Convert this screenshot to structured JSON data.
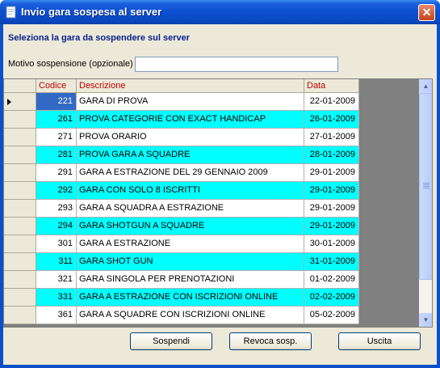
{
  "window": {
    "title": "Invio gara sospesa al server",
    "close_glyph": "✕"
  },
  "heading": "Seleziona la gara da sospendere sul server",
  "motivo": {
    "label": "Motivo sospensione (opzionale)",
    "value": ""
  },
  "grid": {
    "columns": {
      "code": "Codice",
      "desc": "Descrizione",
      "date": "Data"
    },
    "rows": [
      {
        "code": "221",
        "desc": "GARA DI PROVA",
        "date": "22-01-2009",
        "color": "white",
        "selected": true
      },
      {
        "code": "261",
        "desc": "PROVA CATEGORIE CON EXACT HANDICAP",
        "date": "26-01-2009",
        "color": "cyan"
      },
      {
        "code": "271",
        "desc": "PROVA ORARIO",
        "date": "27-01-2009",
        "color": "white"
      },
      {
        "code": "281",
        "desc": "PROVA GARA A SQUADRE",
        "date": "28-01-2009",
        "color": "cyan"
      },
      {
        "code": "291",
        "desc": "GARA A ESTRAZIONE DEL 29 GENNAIO 2009",
        "date": "29-01-2009",
        "color": "white"
      },
      {
        "code": "292",
        "desc": "GARA CON SOLO 8 ISCRITTI",
        "date": "29-01-2009",
        "color": "cyan"
      },
      {
        "code": "293",
        "desc": "GARA A SQUADRA A ESTRAZIONE",
        "date": "29-01-2009",
        "color": "white"
      },
      {
        "code": "294",
        "desc": "GARA SHOTGUN A SQUADRE",
        "date": "29-01-2009",
        "color": "cyan"
      },
      {
        "code": "301",
        "desc": "GARA A ESTRAZIONE",
        "date": "30-01-2009",
        "color": "white"
      },
      {
        "code": "311",
        "desc": "GARA SHOT GUN",
        "date": "31-01-2009",
        "color": "cyan"
      },
      {
        "code": "321",
        "desc": "GARA SINGOLA PER PRENOTAZIONI",
        "date": "01-02-2009",
        "color": "white"
      },
      {
        "code": "331",
        "desc": "GARA A ESTRAZIONE CON ISCRIZIONI ONLINE",
        "date": "02-02-2009",
        "color": "cyan"
      },
      {
        "code": "361",
        "desc": "GARA A SQUADRE CON ISCRIZIONI ONLINE",
        "date": "05-02-2009",
        "color": "white"
      }
    ]
  },
  "buttons": {
    "sospendi": "Sospendi",
    "revoca": "Revoca sosp.",
    "uscita": "Uscita"
  },
  "colors": {
    "cyan_row": "#00ffff",
    "selected_cell": "#316ac5",
    "header_text": "#c00000",
    "heading_text": "#0a1f8c"
  }
}
